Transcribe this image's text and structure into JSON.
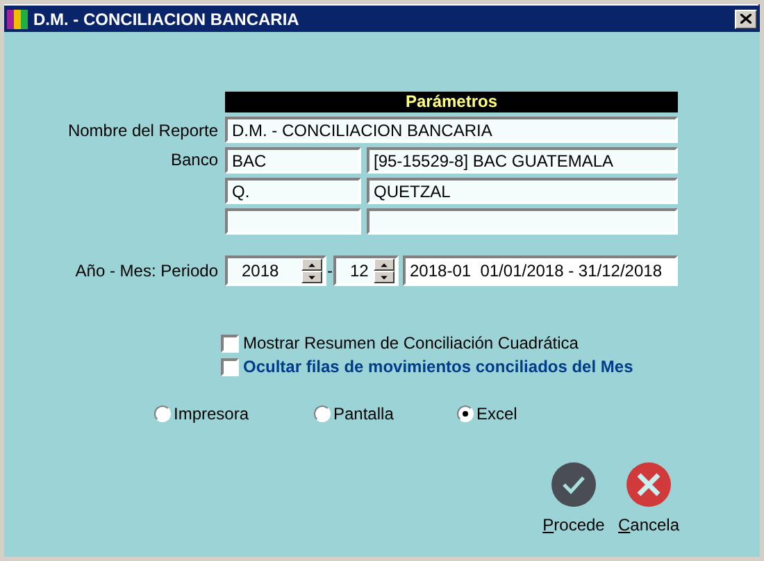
{
  "window": {
    "title": "D.M. - CONCILIACION BANCARIA"
  },
  "parameters": {
    "header": "Parámetros",
    "report_name": {
      "label": "Nombre del Reporte",
      "value": "D.M. - CONCILIACION BANCARIA"
    },
    "bank": {
      "label": "Banco",
      "rows": [
        {
          "code": "BAC",
          "name": "[95-15529-8] BAC GUATEMALA"
        },
        {
          "code": "Q.",
          "name": "QUETZAL"
        },
        {}
      ]
    }
  },
  "period": {
    "label": "Año - Mes: Periodo",
    "year": "2018",
    "separator": "-",
    "month": "12",
    "range": "2018-01  01/01/2018 - 31/12/2018"
  },
  "options": [
    {
      "label": "Mostrar Resumen de Conciliación Cuadrática",
      "checked": false,
      "kind": "plain"
    },
    {
      "label": "Ocultar filas de movimientos conciliados del Mes",
      "checked": false,
      "kind": "highlighted"
    }
  ],
  "output": [
    {
      "label": "Impresora",
      "selected": false
    },
    {
      "label": "Pantalla",
      "selected": false
    },
    {
      "label": "Excel",
      "selected": true
    }
  ],
  "buttons": [
    {
      "label": "Procede",
      "kind": "accept"
    },
    {
      "label": "Cancela",
      "kind": "cancel"
    }
  ]
}
